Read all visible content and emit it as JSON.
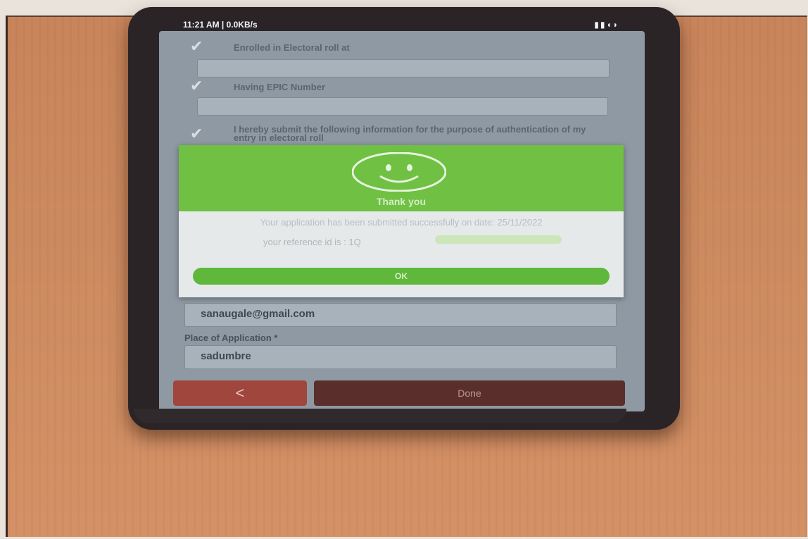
{
  "status_bar": {
    "time": "11:21 AM | 0.0KB/s",
    "icons": "▮▮◖◗"
  },
  "form": {
    "check1_label": "Enrolled in Electoral roll at",
    "check2_label": "Having EPIC Number",
    "check3_label": "I hereby submit the following information for the purpose of authentication of my entry in electoral roll",
    "email_value": "sanaugale@gmail.com",
    "place_label": "Place of Application *",
    "place_value": "sadumbre"
  },
  "dialog": {
    "title": "Thank you",
    "message": "Your application has been submitted successfully on date: 25/11/2022",
    "reference_label": "your reference id is : 1Q",
    "ok_label": "OK"
  },
  "nav": {
    "back_label": "<",
    "done_label": "Done"
  },
  "colors": {
    "dialog_header": "#6fc043",
    "ok_button": "#5fb83b",
    "back_button": "#a0463c",
    "done_button": "#5a2f2b"
  }
}
